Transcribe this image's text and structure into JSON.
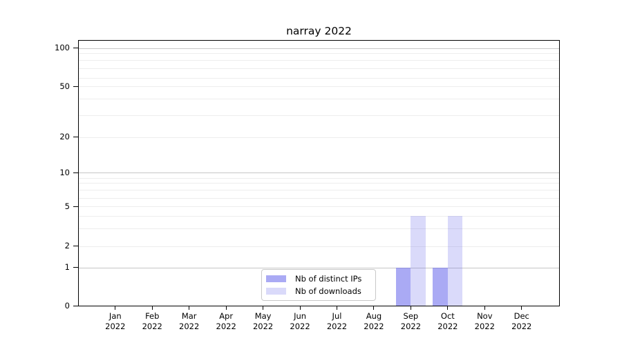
{
  "chart_data": {
    "type": "bar",
    "title": "narray 2022",
    "x_months": [
      "Jan",
      "Feb",
      "Mar",
      "Apr",
      "May",
      "Jun",
      "Jul",
      "Aug",
      "Sep",
      "Oct",
      "Nov",
      "Dec"
    ],
    "x_year": "2022",
    "series": [
      {
        "name": "Nb of distinct IPs",
        "color": "rgba(100,100,235,0.55)",
        "values": [
          0,
          0,
          0,
          0,
          0,
          0,
          0,
          0,
          1,
          1,
          0,
          0
        ]
      },
      {
        "name": "Nb of downloads",
        "color": "rgba(100,100,235,0.24)",
        "values": [
          0,
          0,
          0,
          0,
          0,
          0,
          0,
          0,
          4,
          4,
          0,
          0
        ]
      }
    ],
    "y_axis": {
      "scale": "symlog",
      "tick_labels": [
        0,
        1,
        2,
        5,
        10,
        20,
        50,
        100
      ],
      "major_gridlines": [
        1,
        10,
        100
      ],
      "minor_gridlines": [
        2,
        3,
        4,
        5,
        6,
        7,
        8,
        9,
        20,
        30,
        40,
        50,
        60,
        70,
        80,
        90
      ],
      "range": [
        0,
        120
      ]
    },
    "legend_position": "lower center-left",
    "grid": "on"
  },
  "colors": {
    "bar_distinct_ips": "#aaaaf1",
    "bar_downloads": "#dbdbf8",
    "major_grid": "#c6c6c6",
    "minor_grid": "#ededed",
    "spine": "#000000",
    "legend_border": "#c8c8c8",
    "text": "#000000"
  }
}
